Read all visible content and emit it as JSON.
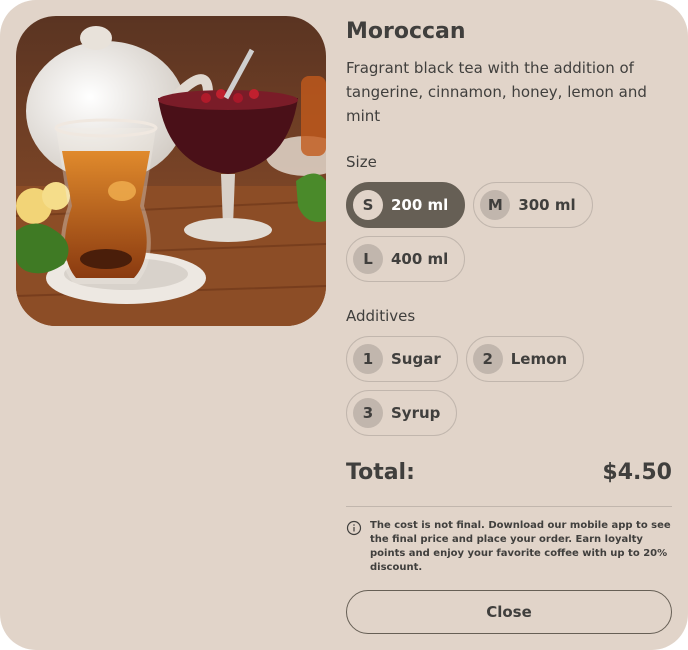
{
  "product": {
    "title": "Moroccan",
    "description": "Fragrant black tea with the addition of tangerine, cinnamon, honey, lemon and mint"
  },
  "size": {
    "label": "Size",
    "options": [
      {
        "badge": "S",
        "label": "200 ml",
        "selected": true
      },
      {
        "badge": "M",
        "label": "300 ml",
        "selected": false
      },
      {
        "badge": "L",
        "label": "400 ml",
        "selected": false
      }
    ]
  },
  "additives": {
    "label": "Additives",
    "options": [
      {
        "badge": "1",
        "label": "Sugar",
        "selected": false
      },
      {
        "badge": "2",
        "label": "Lemon",
        "selected": false
      },
      {
        "badge": "3",
        "label": "Syrup",
        "selected": false
      }
    ]
  },
  "total": {
    "label": "Total:",
    "value": "$4.50"
  },
  "note": {
    "icon": "info-icon",
    "text": "The cost is not final. Download our mobile app to see the final price and place your order. Earn loyalty points and enjoy your favorite coffee with up to 20% discount."
  },
  "close_label": "Close",
  "colors": {
    "background": "#e1d4c9",
    "text": "#403f3d",
    "border": "#c1b6ad",
    "active": "#665f55"
  }
}
